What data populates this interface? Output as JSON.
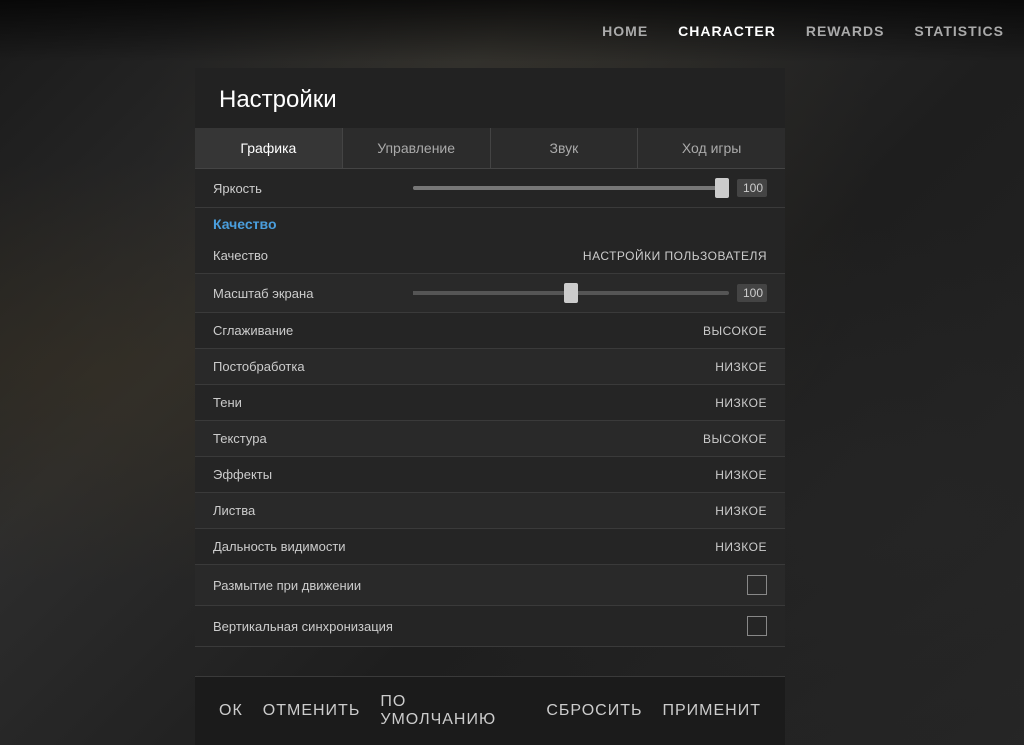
{
  "nav": {
    "items": [
      {
        "id": "home",
        "label": "HOME",
        "active": false
      },
      {
        "id": "character",
        "label": "CHARACTER",
        "active": true
      },
      {
        "id": "rewards",
        "label": "REWARDS",
        "active": false
      },
      {
        "id": "statistics",
        "label": "STATISTICS",
        "active": false
      }
    ]
  },
  "settings": {
    "title": "Настройки",
    "tabs": [
      {
        "id": "graphics",
        "label": "Графика",
        "active": true
      },
      {
        "id": "controls",
        "label": "Управление",
        "active": false
      },
      {
        "id": "sound",
        "label": "Звук",
        "active": false
      },
      {
        "id": "gameplay",
        "label": "Ход игры",
        "active": false
      }
    ],
    "brightness": {
      "label": "Яркость",
      "value": 100
    },
    "quality_section": {
      "title": "Качество"
    },
    "rows": [
      {
        "id": "quality",
        "label": "Качество",
        "value": "НАСТРОЙКИ ПОЛЬЗОВАТЕЛЯ",
        "type": "text"
      },
      {
        "id": "scale",
        "label": "Масштаб экрана",
        "value": 100,
        "type": "slider"
      },
      {
        "id": "antialiasing",
        "label": "Сглаживание",
        "value": "ВЫСОКОЕ",
        "type": "text"
      },
      {
        "id": "postprocess",
        "label": "Постобработка",
        "value": "НИЗКОЕ",
        "type": "text"
      },
      {
        "id": "shadows",
        "label": "Тени",
        "value": "НИЗКОЕ",
        "type": "text"
      },
      {
        "id": "textures",
        "label": "Текстура",
        "value": "ВЫСОКОЕ",
        "type": "text"
      },
      {
        "id": "effects",
        "label": "Эффекты",
        "value": "НИЗКОЕ",
        "type": "text"
      },
      {
        "id": "foliage",
        "label": "Листва",
        "value": "НИЗКОЕ",
        "type": "text"
      },
      {
        "id": "viewdist",
        "label": "Дальность видимости",
        "value": "НИЗКОЕ",
        "type": "text"
      },
      {
        "id": "motionblur",
        "label": "Размытие при движении",
        "value": "",
        "type": "checkbox"
      },
      {
        "id": "vsync",
        "label": "Вертикальная синхронизация",
        "value": "",
        "type": "checkbox"
      }
    ]
  },
  "actions": {
    "ok": "ОК",
    "cancel": "ОТМЕНИТЬ",
    "default": "ПО УМОЛЧАНИЮ",
    "reset": "СБРОСИТЬ",
    "apply": "ПРИМЕНИТ"
  }
}
